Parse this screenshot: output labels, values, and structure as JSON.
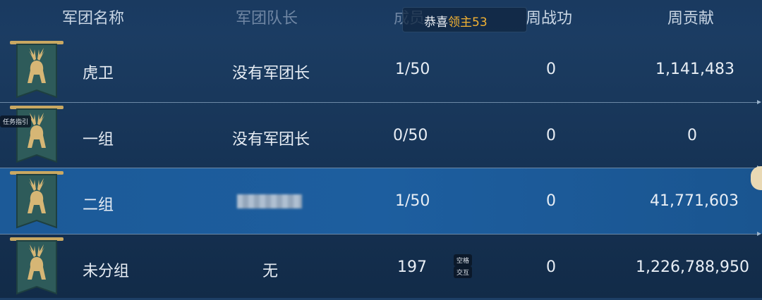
{
  "header": {
    "col_name": "军团名称",
    "col_leader": "军团队长",
    "col_members": "成员",
    "col_weekly_merit": "周战功",
    "col_weekly_contrib": "周贡献"
  },
  "toast": {
    "prefix": "恭喜",
    "highlight": "领主53"
  },
  "rows": [
    {
      "name": "虎卫",
      "leader": "没有军团长",
      "members": "1/50",
      "merit": "0",
      "contrib": "1,141,483",
      "selected": false
    },
    {
      "name": "一组",
      "leader": "没有军团长",
      "members": "0/50",
      "merit": "0",
      "contrib": "0",
      "selected": false
    },
    {
      "name": "二组",
      "leader": "",
      "members": "1/50",
      "merit": "0",
      "contrib": "41,771,603",
      "selected": true
    },
    {
      "name": "未分组",
      "leader": "无",
      "members": "197",
      "merit": "0",
      "contrib": "1,226,788,950",
      "selected": false
    }
  ],
  "overlay_tags": {
    "task_guide": "任务指引",
    "tag_a": "空格",
    "tag_b": "交互"
  },
  "colors": {
    "banner": "#2e5b5a",
    "emblem": "#d6b675",
    "selected_row": "#1d5e9f",
    "toast_highlight": "#f2b233"
  },
  "icons": {
    "row_emblem": "deer-banner-icon"
  }
}
